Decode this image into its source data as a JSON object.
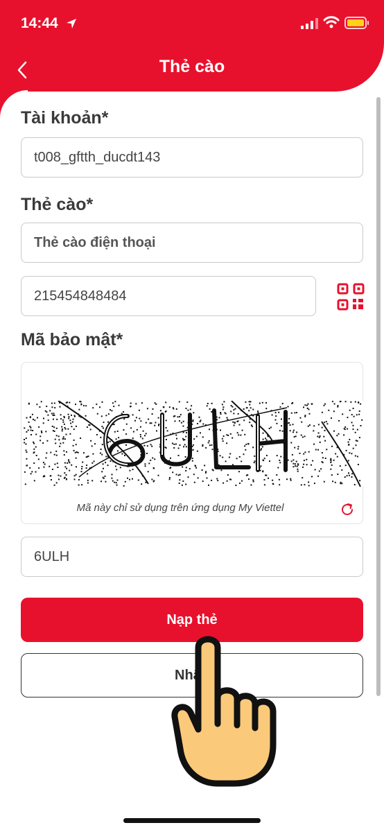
{
  "status_bar": {
    "time": "14:44",
    "icons": [
      "location-arrow-icon",
      "signal-icon",
      "wifi-icon",
      "battery-icon"
    ]
  },
  "header": {
    "title": "Thẻ cào",
    "back_icon": "chevron-left-icon"
  },
  "form": {
    "account_label": "Tài khoản*",
    "account_value": "t008_gftth_ducdt143",
    "card_label": "Thẻ cào*",
    "card_type_value": "Thẻ cào điện thoại",
    "card_number_value": "215454848484",
    "security_label": "Mã bảo mật*",
    "captcha_note": "Mã này chỉ sử dụng trên ứng dụng My Viettel",
    "captcha_value": "6ULH"
  },
  "buttons": {
    "submit_label": "Nạp thẻ",
    "secondary_label": "Nhập"
  },
  "colors": {
    "brand": "#e8112d",
    "text": "#3a3a3a",
    "border": "#c9c9c9"
  }
}
